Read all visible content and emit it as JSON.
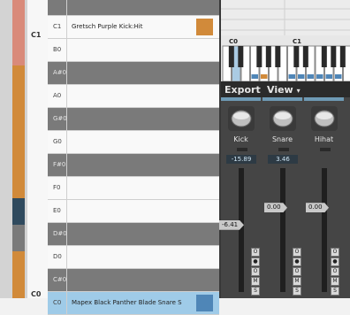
{
  "notes_panel": {
    "octave_labels": [
      "C1",
      "C0"
    ],
    "rows": [
      {
        "note": "",
        "sample": "",
        "kind": "black"
      },
      {
        "note": "C1",
        "sample": "Gretsch Purple Kick:Hit",
        "kind": "white",
        "swatch": "#d18a3a"
      },
      {
        "note": "B0",
        "sample": "",
        "kind": "white"
      },
      {
        "note": "A#0",
        "sample": "",
        "kind": "black"
      },
      {
        "note": "A0",
        "sample": "",
        "kind": "white"
      },
      {
        "note": "G#0",
        "sample": "",
        "kind": "black"
      },
      {
        "note": "G0",
        "sample": "",
        "kind": "white"
      },
      {
        "note": "F#0",
        "sample": "",
        "kind": "black"
      },
      {
        "note": "F0",
        "sample": "",
        "kind": "white"
      },
      {
        "note": "E0",
        "sample": "",
        "kind": "white"
      },
      {
        "note": "D#0",
        "sample": "",
        "kind": "black"
      },
      {
        "note": "D0",
        "sample": "",
        "kind": "white"
      },
      {
        "note": "C#0",
        "sample": "",
        "kind": "black"
      },
      {
        "note": "C0",
        "sample": "Mapex Black Panther Blade Snare S",
        "kind": "white",
        "highlight": true,
        "swatch": "#4f86b7"
      }
    ]
  },
  "keyboard": {
    "labels": [
      "C0",
      "C1"
    ]
  },
  "menu": {
    "export_label": "Export",
    "view_label": "View",
    "view_arrow": "▾"
  },
  "mixer": {
    "strips": [
      {
        "name": "Kick",
        "icon": "kick-drum-icon",
        "value": "-15.89",
        "fader_label": "-6.41",
        "fader_level_percent": 58
      },
      {
        "name": "Snare",
        "icon": "snare-drum-icon",
        "value": "3.46",
        "fader_label": "0.00",
        "fader_level_percent": 72
      },
      {
        "name": "Hihat",
        "icon": "hihat-icon",
        "value": "",
        "fader_label": "0.00",
        "fader_level_percent": 72
      }
    ],
    "button_labels": [
      "O",
      "●",
      "O",
      "M",
      "S"
    ]
  },
  "colors": {
    "accent_orange": "#d18a3a",
    "accent_blue": "#4f86b7",
    "dark_panel": "#383838"
  }
}
